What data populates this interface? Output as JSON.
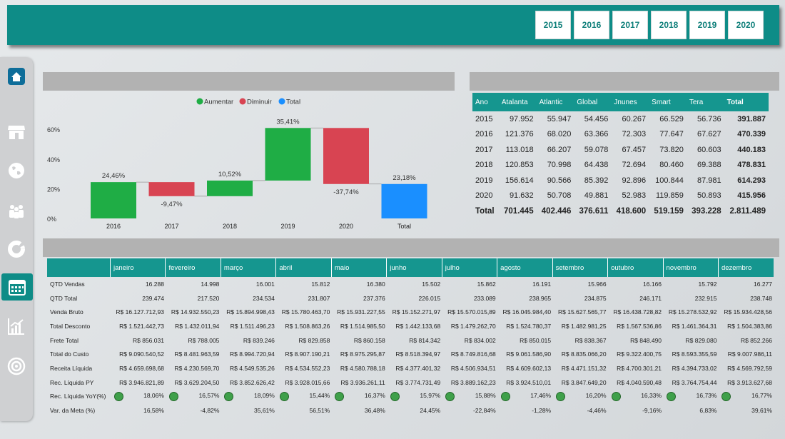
{
  "header": {
    "years": [
      "2015",
      "2016",
      "2017",
      "2018",
      "2019",
      "2020"
    ]
  },
  "sidebar": {
    "items": [
      {
        "name": "home-icon"
      },
      {
        "name": "store-icon"
      },
      {
        "name": "globe-icon"
      },
      {
        "name": "people-icon"
      },
      {
        "name": "donut-chart-icon"
      },
      {
        "name": "calendar-icon"
      },
      {
        "name": "growth-chart-icon"
      },
      {
        "name": "target-icon"
      }
    ]
  },
  "chart_data": {
    "type": "bar",
    "legend": [
      "Aumentar",
      "Diminuir",
      "Total"
    ],
    "legend_position": "top-center",
    "colors": {
      "increase": "#1fad45",
      "decrease": "#d84452",
      "total": "#1a8fff"
    },
    "categories": [
      "2016",
      "2017",
      "2018",
      "2019",
      "2020",
      "Total"
    ],
    "values": [
      24.46,
      -9.47,
      10.52,
      35.41,
      -37.74,
      23.18
    ],
    "labels": [
      "24,46%",
      "-9,47%",
      "10,52%",
      "35,41%",
      "-37,74%",
      "23,18%"
    ],
    "kinds": [
      "increase",
      "decrease",
      "increase",
      "increase",
      "decrease",
      "total"
    ],
    "yticks": [
      "0%",
      "20%",
      "40%",
      "60%"
    ],
    "ylim": [
      0,
      70
    ],
    "grid": false
  },
  "year_table": {
    "headers": [
      "Ano",
      "Atalanta",
      "Atlantic",
      "Global",
      "Jnunes",
      "Smart",
      "Tera",
      "Total"
    ],
    "rows": [
      [
        "2015",
        "97.952",
        "55.947",
        "54.456",
        "60.267",
        "66.529",
        "56.736",
        "391.887"
      ],
      [
        "2016",
        "121.376",
        "68.020",
        "63.366",
        "72.303",
        "77.647",
        "67.627",
        "470.339"
      ],
      [
        "2017",
        "113.018",
        "66.207",
        "59.078",
        "67.457",
        "73.820",
        "60.603",
        "440.183"
      ],
      [
        "2018",
        "120.853",
        "70.998",
        "64.438",
        "72.694",
        "80.460",
        "69.388",
        "478.831"
      ],
      [
        "2019",
        "156.614",
        "90.566",
        "85.392",
        "92.896",
        "100.844",
        "87.981",
        "614.293"
      ],
      [
        "2020",
        "91.632",
        "50.708",
        "49.881",
        "52.983",
        "119.859",
        "50.893",
        "415.956"
      ]
    ],
    "total_row": [
      "Total",
      "701.445",
      "402.446",
      "376.611",
      "418.600",
      "519.159",
      "393.228",
      "2.811.489"
    ]
  },
  "month_table": {
    "months": [
      "janeiro",
      "fevereiro",
      "março",
      "abril",
      "maio",
      "junho",
      "julho",
      "agosto",
      "setembro",
      "outubro",
      "novembro",
      "dezembro"
    ],
    "rows": [
      {
        "label": "QTD Vendas",
        "values": [
          "16.288",
          "14.998",
          "16.001",
          "15.812",
          "16.380",
          "15.502",
          "15.862",
          "16.191",
          "15.966",
          "16.166",
          "15.792",
          "16.277"
        ]
      },
      {
        "label": "QTD Total",
        "values": [
          "239.474",
          "217.520",
          "234.534",
          "231.807",
          "237.376",
          "226.015",
          "233.089",
          "238.965",
          "234.875",
          "246.171",
          "232.915",
          "238.748"
        ]
      },
      {
        "label": "Venda Bruto",
        "values": [
          "R$ 16.127.712,93",
          "R$ 14.932.550,23",
          "R$ 15.894.998,43",
          "R$ 15.780.463,70",
          "R$ 15.931.227,55",
          "R$ 15.152.271,97",
          "R$ 15.570.015,89",
          "R$ 16.045.984,40",
          "R$ 15.627.565,77",
          "R$ 16.438.728,82",
          "R$ 15.278.532,92",
          "R$ 15.934.428,56"
        ]
      },
      {
        "label": "Total Desconto",
        "values": [
          "R$ 1.521.442,73",
          "R$ 1.432.011,94",
          "R$ 1.511.496,23",
          "R$ 1.508.863,26",
          "R$ 1.514.985,50",
          "R$ 1.442.133,68",
          "R$ 1.479.262,70",
          "R$ 1.524.780,37",
          "R$ 1.482.981,25",
          "R$ 1.567.536,86",
          "R$ 1.461.364,31",
          "R$ 1.504.383,86"
        ]
      },
      {
        "label": "Frete Total",
        "values": [
          "R$ 856.031",
          "R$ 788.005",
          "R$ 839.246",
          "R$ 829.858",
          "R$ 860.158",
          "R$ 814.342",
          "R$ 834.002",
          "R$ 850.015",
          "R$ 838.367",
          "R$ 848.490",
          "R$ 829.080",
          "R$ 852.266"
        ]
      },
      {
        "label": "Total do Custo",
        "values": [
          "R$ 9.090.540,52",
          "R$ 8.481.963,59",
          "R$ 8.994.720,94",
          "R$ 8.907.190,21",
          "R$ 8.975.295,87",
          "R$ 8.518.394,97",
          "R$ 8.749.816,68",
          "R$ 9.061.586,90",
          "R$ 8.835.066,20",
          "R$ 9.322.400,75",
          "R$ 8.593.355,59",
          "R$ 9.007.986,11"
        ]
      },
      {
        "label": "Receita Líquida",
        "values": [
          "R$ 4.659.698,68",
          "R$ 4.230.569,70",
          "R$ 4.549.535,26",
          "R$ 4.534.552,23",
          "R$ 4.580.788,18",
          "R$ 4.377.401,32",
          "R$ 4.506.934,51",
          "R$ 4.609.602,13",
          "R$ 4.471.151,32",
          "R$ 4.700.301,21",
          "R$ 4.394.733,02",
          "R$ 4.569.792,59"
        ]
      },
      {
        "label": "Rec. Líquida PY",
        "values": [
          "R$ 3.946.821,89",
          "R$ 3.629.204,50",
          "R$ 3.852.626,42",
          "R$ 3.928.015,66",
          "R$ 3.936.261,11",
          "R$ 3.774.731,49",
          "R$ 3.889.162,23",
          "R$ 3.924.510,01",
          "R$ 3.847.649,20",
          "R$ 4.040.590,48",
          "R$ 3.764.754,44",
          "R$ 3.913.627,68"
        ]
      },
      {
        "label": "Rec. Líquida YoY(%)",
        "kpi": true,
        "values": [
          "18,06%",
          "16,57%",
          "18,09%",
          "15,44%",
          "16,37%",
          "15,97%",
          "15,88%",
          "17,46%",
          "16,20%",
          "16,33%",
          "16,73%",
          "16,77%"
        ]
      },
      {
        "label": "Var. da Meta (%)",
        "values": [
          "16,58%",
          "-4,82%",
          "35,61%",
          "56,51%",
          "36,48%",
          "24,45%",
          "-22,84%",
          "-1,28%",
          "-4,46%",
          "-9,16%",
          "6,83%",
          "39,61%"
        ]
      }
    ]
  }
}
